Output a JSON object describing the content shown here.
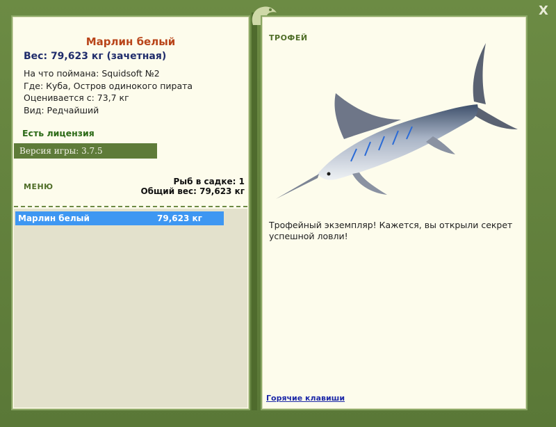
{
  "window": {
    "close_label": "X"
  },
  "fish": {
    "name": "Марлин белый",
    "weight": "Вес: 79,623 кг (зачетная)",
    "caught_on": "На что поймана: Squidsoft №2",
    "location": "Где: Куба, Остров одинокого пирата",
    "valued_from": "Оценивается с: 73,7 кг",
    "kind": "Вид: Редчайший"
  },
  "license": "Есть лицензия",
  "version": "Версия игры: 3.7.5",
  "menu_label": "МЕНЮ",
  "cage": {
    "count": "Рыб в садке: 1",
    "total_weight": "Общий вес: 79,623 кг"
  },
  "fish_list": [
    {
      "name": "Марлин белый",
      "weight": "79,623 кг"
    }
  ],
  "trophy": {
    "label": "ТРОФЕЙ",
    "description": "Трофейный экземпляр! Кажется, вы открыли секрет успешной ловли!"
  },
  "hotkeys_label": "Горячие клавиши",
  "colors": {
    "frame": "#5f7d3b",
    "panel": "#fdfcec",
    "highlight": "#3e97f2",
    "fish_title": "#b9451a"
  }
}
